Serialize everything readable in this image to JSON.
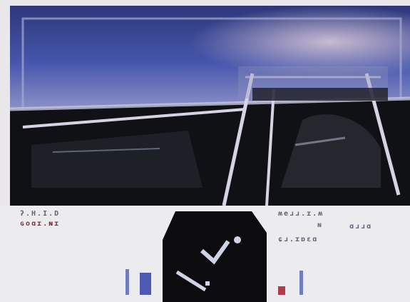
{
  "colors": {
    "sky_top": "#2d3a7c",
    "sky_mid": "#4d5ab4",
    "horizon_glow": "#b7a7c8",
    "ground": "#0f1115",
    "lane_white": "#d7d3e4",
    "hud_bg": "#ecebee",
    "hud_text": "#5b6578",
    "hud_red": "#8a2a3a",
    "gauge_blue": "#6f7ec0",
    "gauge_red": "#b23a4a"
  },
  "icons": {
    "radar": "radar-scope-icon",
    "pointer": "arrow-pointer-icon"
  },
  "hud": {
    "left_label_top": "ʔ.H.I.D",
    "left_label_bottom": "ɢoɑɪ.ɴɪ",
    "right_label_top": "ʍeɹɹ.ɪ.ʍ",
    "right_label_mid": "ɴ",
    "right_label_mid_2": "ɑɹɹɑ",
    "right_label_bottom": "ɕɹ.ɪɒɛɑ",
    "gauges": {
      "blue_left_level": 0.55,
      "blue_right_level": 0.28,
      "red_level": 0.12,
      "red_right_level": 0.34
    }
  }
}
